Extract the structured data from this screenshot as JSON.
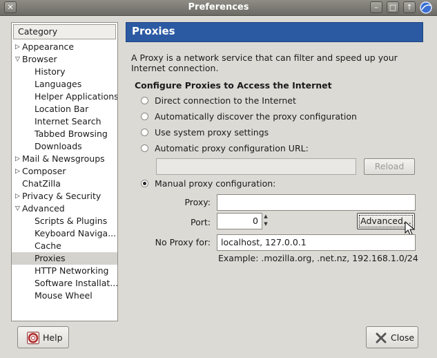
{
  "window": {
    "title": "Preferences",
    "titlebar_buttons": [
      "close",
      "minimize",
      "maximize",
      "roll-up"
    ]
  },
  "sidebar": {
    "header": "Category",
    "items": [
      {
        "label": "Appearance",
        "level": 0,
        "expander": "collapsed"
      },
      {
        "label": "Browser",
        "level": 0,
        "expander": "expanded"
      },
      {
        "label": "History",
        "level": 1
      },
      {
        "label": "Languages",
        "level": 1
      },
      {
        "label": "Helper Applications",
        "level": 1
      },
      {
        "label": "Location Bar",
        "level": 1
      },
      {
        "label": "Internet Search",
        "level": 1
      },
      {
        "label": "Tabbed Browsing",
        "level": 1
      },
      {
        "label": "Downloads",
        "level": 1
      },
      {
        "label": "Mail & Newsgroups",
        "level": 0,
        "expander": "collapsed"
      },
      {
        "label": "Composer",
        "level": 0,
        "expander": "collapsed"
      },
      {
        "label": "ChatZilla",
        "level": 0
      },
      {
        "label": "Privacy & Security",
        "level": 0,
        "expander": "collapsed"
      },
      {
        "label": "Advanced",
        "level": 0,
        "expander": "expanded"
      },
      {
        "label": "Scripts & Plugins",
        "level": 1
      },
      {
        "label": "Keyboard Naviga...",
        "level": 1
      },
      {
        "label": "Cache",
        "level": 1
      },
      {
        "label": "Proxies",
        "level": 1,
        "selected": true
      },
      {
        "label": "HTTP Networking",
        "level": 1
      },
      {
        "label": "Software Installat...",
        "level": 1
      },
      {
        "label": "Mouse Wheel",
        "level": 1
      }
    ]
  },
  "main": {
    "title": "Proxies",
    "description": "A Proxy is a network service that can filter and speed up your Internet connection.",
    "section_title": "Configure Proxies to Access the Internet",
    "options": {
      "direct": "Direct connection to the Internet",
      "auto_detect": "Automatically discover the proxy configuration",
      "system": "Use system proxy settings",
      "auto_url": "Automatic proxy configuration URL:",
      "manual": "Manual proxy configuration:"
    },
    "selected_option": "manual",
    "auto_url_value": "",
    "reload_label": "Reload",
    "proxy_label": "Proxy:",
    "proxy_value": "",
    "port_label": "Port:",
    "port_value": "0",
    "advanced_label": "Advanced...",
    "no_proxy_label": "No Proxy for:",
    "no_proxy_value": "localhost, 127.0.0.1",
    "example_text": "Example: .mozilla.org, .net.nz, 192.168.1.0/24"
  },
  "footer": {
    "help_label": "Help",
    "close_label": "Close"
  },
  "colors": {
    "title_bar_blue": "#2b5aa3",
    "window_bg": "#dcdad5",
    "selection": "#d3d2cc"
  }
}
